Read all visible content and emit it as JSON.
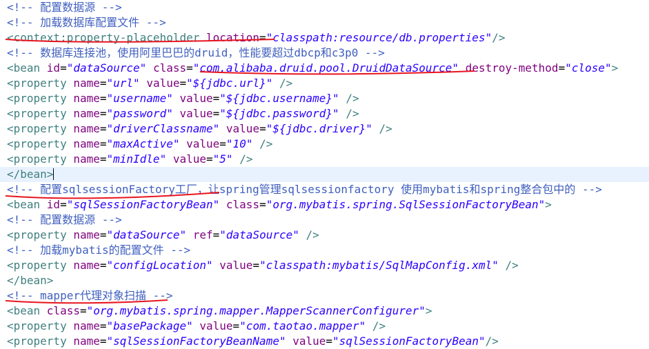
{
  "editor": {
    "lines": [
      [
        {
          "c": "comment",
          "t": "<!-- 配置数据源 -->"
        }
      ],
      [
        {
          "c": "comment",
          "t": "<!-- 加载数据库配置文件 -->"
        }
      ],
      [
        {
          "c": "tag",
          "t": "<context:property-placeholder "
        },
        {
          "c": "attr",
          "t": "location"
        },
        {
          "c": "txt",
          "t": "="
        },
        {
          "c": "val",
          "t": "\"classpath:resource/db.properties\""
        },
        {
          "c": "tag",
          "t": "/>"
        }
      ],
      [
        {
          "c": "comment",
          "t": "<!-- 数据库连接池，使用阿里巴巴的druid，性能要超过dbcp和c3p0 -->"
        }
      ],
      [
        {
          "c": "tag",
          "t": "<bean "
        },
        {
          "c": "attr",
          "t": "id"
        },
        {
          "c": "txt",
          "t": "="
        },
        {
          "c": "val",
          "t": "\"dataSource\""
        },
        {
          "c": "txt",
          "t": " "
        },
        {
          "c": "attr",
          "t": "class"
        },
        {
          "c": "txt",
          "t": "="
        },
        {
          "c": "val",
          "t": "\"com.alibaba.druid.pool.DruidDataSource\""
        },
        {
          "c": "txt",
          "t": " "
        },
        {
          "c": "attr",
          "t": "destroy-method"
        },
        {
          "c": "txt",
          "t": "="
        },
        {
          "c": "val",
          "t": "\"close\""
        },
        {
          "c": "tag",
          "t": ">"
        }
      ],
      [
        {
          "c": "tag",
          "t": "<property "
        },
        {
          "c": "attr",
          "t": "name"
        },
        {
          "c": "txt",
          "t": "="
        },
        {
          "c": "val",
          "t": "\"url\""
        },
        {
          "c": "txt",
          "t": " "
        },
        {
          "c": "attr",
          "t": "value"
        },
        {
          "c": "txt",
          "t": "="
        },
        {
          "c": "val",
          "t": "\"${jdbc.url}\""
        },
        {
          "c": "txt",
          "t": " "
        },
        {
          "c": "tag",
          "t": "/>"
        }
      ],
      [
        {
          "c": "tag",
          "t": "<property "
        },
        {
          "c": "attr",
          "t": "name"
        },
        {
          "c": "txt",
          "t": "="
        },
        {
          "c": "val",
          "t": "\"username\""
        },
        {
          "c": "txt",
          "t": " "
        },
        {
          "c": "attr",
          "t": "value"
        },
        {
          "c": "txt",
          "t": "="
        },
        {
          "c": "val",
          "t": "\"${jdbc.username}\""
        },
        {
          "c": "txt",
          "t": " "
        },
        {
          "c": "tag",
          "t": "/>"
        }
      ],
      [
        {
          "c": "tag",
          "t": "<property "
        },
        {
          "c": "attr",
          "t": "name"
        },
        {
          "c": "txt",
          "t": "="
        },
        {
          "c": "val",
          "t": "\"password\""
        },
        {
          "c": "txt",
          "t": " "
        },
        {
          "c": "attr",
          "t": "value"
        },
        {
          "c": "txt",
          "t": "="
        },
        {
          "c": "val",
          "t": "\"${jdbc.password}\""
        },
        {
          "c": "txt",
          "t": " "
        },
        {
          "c": "tag",
          "t": "/>"
        }
      ],
      [
        {
          "c": "tag",
          "t": "<property "
        },
        {
          "c": "attr",
          "t": "name"
        },
        {
          "c": "txt",
          "t": "="
        },
        {
          "c": "val",
          "t": "\"driverClassname\""
        },
        {
          "c": "txt",
          "t": " "
        },
        {
          "c": "attr",
          "t": "value"
        },
        {
          "c": "txt",
          "t": "="
        },
        {
          "c": "val",
          "t": "\"${jdbc.driver}\""
        },
        {
          "c": "txt",
          "t": " "
        },
        {
          "c": "tag",
          "t": "/>"
        }
      ],
      [
        {
          "c": "tag",
          "t": "<property "
        },
        {
          "c": "attr",
          "t": "name"
        },
        {
          "c": "txt",
          "t": "="
        },
        {
          "c": "val",
          "t": "\"maxActive\""
        },
        {
          "c": "txt",
          "t": " "
        },
        {
          "c": "attr",
          "t": "value"
        },
        {
          "c": "txt",
          "t": "="
        },
        {
          "c": "val",
          "t": "\"10\""
        },
        {
          "c": "txt",
          "t": " "
        },
        {
          "c": "tag",
          "t": "/>"
        }
      ],
      [
        {
          "c": "tag",
          "t": "<property "
        },
        {
          "c": "attr",
          "t": "name"
        },
        {
          "c": "txt",
          "t": "="
        },
        {
          "c": "val",
          "t": "\"minIdle\""
        },
        {
          "c": "txt",
          "t": " "
        },
        {
          "c": "attr",
          "t": "value"
        },
        {
          "c": "txt",
          "t": "="
        },
        {
          "c": "val",
          "t": "\"5\""
        },
        {
          "c": "txt",
          "t": " "
        },
        {
          "c": "tag",
          "t": "/>"
        }
      ],
      [
        {
          "c": "tag",
          "t": "</bean>"
        }
      ],
      [
        {
          "c": "comment",
          "t": "<!-- 配置sqlsessionFactory工厂，让spring管理sqlsessionfactory 使用mybatis和spring整合包中的 -->"
        }
      ],
      [
        {
          "c": "tag",
          "t": "<bean "
        },
        {
          "c": "attr",
          "t": "id"
        },
        {
          "c": "txt",
          "t": "="
        },
        {
          "c": "val",
          "t": "\"sqlSessionFactoryBean\""
        },
        {
          "c": "txt",
          "t": " "
        },
        {
          "c": "attr",
          "t": "class"
        },
        {
          "c": "txt",
          "t": "="
        },
        {
          "c": "val",
          "t": "\"org.mybatis.spring.SqlSessionFactoryBean\""
        },
        {
          "c": "tag",
          "t": ">"
        }
      ],
      [
        {
          "c": "comment",
          "t": "<!-- 配置数据源 -->"
        }
      ],
      [
        {
          "c": "tag",
          "t": "<property "
        },
        {
          "c": "attr",
          "t": "name"
        },
        {
          "c": "txt",
          "t": "="
        },
        {
          "c": "val",
          "t": "\"dataSource\""
        },
        {
          "c": "txt",
          "t": " "
        },
        {
          "c": "attr",
          "t": "ref"
        },
        {
          "c": "txt",
          "t": "="
        },
        {
          "c": "val",
          "t": "\"dataSource\""
        },
        {
          "c": "txt",
          "t": " "
        },
        {
          "c": "tag",
          "t": "/>"
        }
      ],
      [
        {
          "c": "comment",
          "t": "<!-- 加载mybatis的配置文件 -->"
        }
      ],
      [
        {
          "c": "tag",
          "t": "<property "
        },
        {
          "c": "attr",
          "t": "name"
        },
        {
          "c": "txt",
          "t": "="
        },
        {
          "c": "val",
          "t": "\"configLocation\""
        },
        {
          "c": "txt",
          "t": " "
        },
        {
          "c": "attr",
          "t": "value"
        },
        {
          "c": "txt",
          "t": "="
        },
        {
          "c": "val",
          "t": "\"classpath:mybatis/SqlMapConfig.xml\""
        },
        {
          "c": "txt",
          "t": " "
        },
        {
          "c": "tag",
          "t": "/>"
        }
      ],
      [
        {
          "c": "tag",
          "t": "</bean>"
        }
      ],
      [
        {
          "c": "comment",
          "t": "<!-- mapper代理对象扫描 -->"
        }
      ],
      [
        {
          "c": "tag",
          "t": "<bean "
        },
        {
          "c": "attr",
          "t": "class"
        },
        {
          "c": "txt",
          "t": "="
        },
        {
          "c": "val",
          "t": "\"org.mybatis.spring.mapper.MapperScannerConfigurer\""
        },
        {
          "c": "tag",
          "t": ">"
        }
      ],
      [
        {
          "c": "tag",
          "t": "<property "
        },
        {
          "c": "attr",
          "t": "name"
        },
        {
          "c": "txt",
          "t": "="
        },
        {
          "c": "val",
          "t": "\"basePackage\""
        },
        {
          "c": "txt",
          "t": " "
        },
        {
          "c": "attr",
          "t": "value"
        },
        {
          "c": "txt",
          "t": "="
        },
        {
          "c": "val",
          "t": "\"com.taotao.mapper\""
        },
        {
          "c": "txt",
          "t": " "
        },
        {
          "c": "tag",
          "t": "/>"
        }
      ],
      [
        {
          "c": "tag",
          "t": "<property "
        },
        {
          "c": "attr",
          "t": "name"
        },
        {
          "c": "txt",
          "t": "="
        },
        {
          "c": "val",
          "t": "\"sqlSessionFactoryBeanName\""
        },
        {
          "c": "txt",
          "t": " "
        },
        {
          "c": "attr",
          "t": "value"
        },
        {
          "c": "txt",
          "t": "="
        },
        {
          "c": "val",
          "t": "\"sqlSessionFactoryBean\""
        },
        {
          "c": "tag",
          "t": "/>"
        }
      ]
    ],
    "current_line": 11,
    "colors": {
      "comment": "#3f5fbf",
      "tag": "#3f7f7f",
      "attribute": "#7f007f",
      "value": "#2a00ff",
      "annotation_underline": "#e8141e",
      "current_line_highlight": "#e8f2fe"
    }
  }
}
